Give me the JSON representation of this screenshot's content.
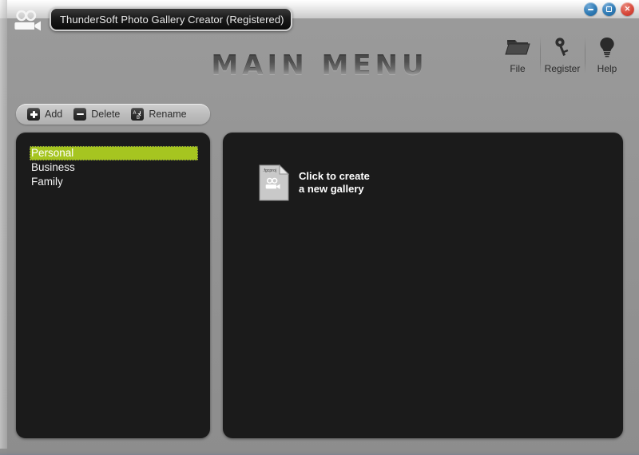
{
  "window": {
    "title": "ThunderSoft Photo Gallery Creator (Registered)",
    "app_icon": "video-camera-icon",
    "controls": [
      {
        "name": "minimize",
        "label": "–",
        "color": "#2f7bb5"
      },
      {
        "name": "maximize",
        "label": "□",
        "color": "#2f7bb5"
      },
      {
        "name": "close",
        "label": "✕",
        "color": "#d8493a"
      }
    ]
  },
  "header": {
    "heading": "MAIN MENU",
    "tools": [
      {
        "id": "file",
        "label": "File",
        "icon": "folder-icon"
      },
      {
        "id": "register",
        "label": "Register",
        "icon": "key-icon"
      },
      {
        "id": "help",
        "label": "Help",
        "icon": "lightbulb-icon"
      }
    ]
  },
  "list_toolbar": {
    "buttons": [
      {
        "id": "add",
        "label": "Add",
        "icon": "plus-icon"
      },
      {
        "id": "delete",
        "label": "Delete",
        "icon": "minus-icon"
      },
      {
        "id": "rename",
        "label": "Rename",
        "icon": "rename-ab-icon"
      }
    ]
  },
  "gallery_list": {
    "items": [
      {
        "label": "Personal",
        "selected": true
      },
      {
        "label": "Business",
        "selected": false
      },
      {
        "label": "Family",
        "selected": false
      }
    ],
    "highlight_color": "#a6c520"
  },
  "content_panel": {
    "create_entry": {
      "icon": "fgcproj-file-icon",
      "file_extension": ".fgcproj",
      "line1": "Click to create",
      "line2": "a new gallery"
    }
  },
  "colors": {
    "panel_background": "#1b1b1b",
    "window_background": "#929292",
    "accent": "#a6c520"
  }
}
